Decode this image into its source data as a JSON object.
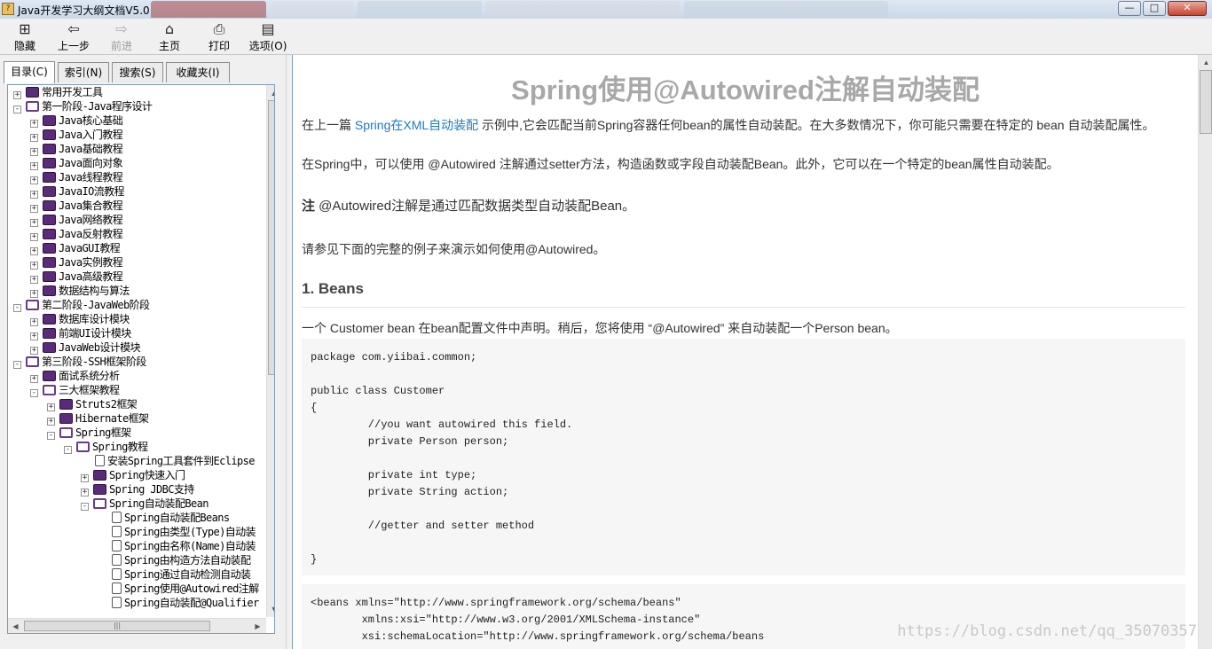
{
  "window": {
    "title": "Java开发学习大纲文档V5.0",
    "app_icon": "chm-book-icon",
    "controls": {
      "minimize": "—",
      "maximize": "□",
      "close": "✕"
    },
    "blurred_tab_colors": [
      "#a84444",
      "#d8dde4",
      "#c9d3df",
      "#d4d9e0",
      "#c8d2de"
    ]
  },
  "toolbar": {
    "buttons": [
      {
        "id": "hide",
        "label": "隐藏",
        "icon": "hide-pane-icon",
        "glyph": "⊞",
        "enabled": true
      },
      {
        "id": "back",
        "label": "上一步",
        "icon": "back-arrow-icon",
        "glyph": "⇦",
        "enabled": true
      },
      {
        "id": "forward",
        "label": "前进",
        "icon": "forward-arrow-icon",
        "glyph": "⇨",
        "enabled": false
      },
      {
        "id": "home",
        "label": "主页",
        "icon": "home-icon",
        "glyph": "⌂",
        "enabled": true
      },
      {
        "id": "print",
        "label": "打印",
        "icon": "printer-icon",
        "glyph": "⎙",
        "enabled": true
      },
      {
        "id": "options",
        "label": "选项(O)",
        "icon": "options-icon",
        "glyph": "▤",
        "enabled": true
      }
    ]
  },
  "nav_tabs": [
    {
      "label": "目录(C)",
      "active": true
    },
    {
      "label": "索引(N)",
      "active": false
    },
    {
      "label": "搜索(S)",
      "active": false
    },
    {
      "label": "收藏夹(I)",
      "active": false
    }
  ],
  "tree": [
    {
      "label": "常用开发工具",
      "level": 0,
      "expander": "+",
      "icon": "closed"
    },
    {
      "label": "第一阶段-Java程序设计",
      "level": 0,
      "expander": "-",
      "icon": "open"
    },
    {
      "label": "Java核心基础",
      "level": 1,
      "expander": "+",
      "icon": "closed"
    },
    {
      "label": "Java入门教程",
      "level": 1,
      "expander": "+",
      "icon": "closed"
    },
    {
      "label": "Java基础教程",
      "level": 1,
      "expander": "+",
      "icon": "closed"
    },
    {
      "label": "Java面向对象",
      "level": 1,
      "expander": "+",
      "icon": "closed"
    },
    {
      "label": "Java线程教程",
      "level": 1,
      "expander": "+",
      "icon": "closed"
    },
    {
      "label": "JavaIO流教程",
      "level": 1,
      "expander": "+",
      "icon": "closed"
    },
    {
      "label": "Java集合教程",
      "level": 1,
      "expander": "+",
      "icon": "closed"
    },
    {
      "label": "Java网络教程",
      "level": 1,
      "expander": "+",
      "icon": "closed"
    },
    {
      "label": "Java反射教程",
      "level": 1,
      "expander": "+",
      "icon": "closed"
    },
    {
      "label": "JavaGUI教程",
      "level": 1,
      "expander": "+",
      "icon": "closed"
    },
    {
      "label": "Java实例教程",
      "level": 1,
      "expander": "+",
      "icon": "closed"
    },
    {
      "label": "Java高级教程",
      "level": 1,
      "expander": "+",
      "icon": "closed"
    },
    {
      "label": "数据结构与算法",
      "level": 1,
      "expander": "+",
      "icon": "closed"
    },
    {
      "label": "第二阶段-JavaWeb阶段",
      "level": 0,
      "expander": "-",
      "icon": "open"
    },
    {
      "label": "数据库设计模块",
      "level": 1,
      "expander": "+",
      "icon": "closed"
    },
    {
      "label": "前端UI设计模块",
      "level": 1,
      "expander": "+",
      "icon": "closed"
    },
    {
      "label": "JavaWeb设计模块",
      "level": 1,
      "expander": "+",
      "icon": "closed"
    },
    {
      "label": "第三阶段-SSH框架阶段",
      "level": 0,
      "expander": "-",
      "icon": "open"
    },
    {
      "label": "面试系统分析",
      "level": 1,
      "expander": "+",
      "icon": "closed"
    },
    {
      "label": "三大框架教程",
      "level": 1,
      "expander": "-",
      "icon": "open"
    },
    {
      "label": "Struts2框架",
      "level": 2,
      "expander": "+",
      "icon": "closed"
    },
    {
      "label": "Hibernate框架",
      "level": 2,
      "expander": "+",
      "icon": "closed"
    },
    {
      "label": "Spring框架",
      "level": 2,
      "expander": "-",
      "icon": "open"
    },
    {
      "label": "Spring教程",
      "level": 3,
      "expander": "-",
      "icon": "open"
    },
    {
      "label": "安装Spring工具套件到Eclipse",
      "level": 4,
      "expander": "",
      "icon": "page"
    },
    {
      "label": "Spring快速入门",
      "level": 4,
      "expander": "+",
      "icon": "closed"
    },
    {
      "label": "Spring JDBC支持",
      "level": 4,
      "expander": "+",
      "icon": "closed"
    },
    {
      "label": "Spring自动装配Bean",
      "level": 4,
      "expander": "-",
      "icon": "open"
    },
    {
      "label": "Spring自动装配Beans",
      "level": 5,
      "expander": "",
      "icon": "page"
    },
    {
      "label": "Spring由类型(Type)自动装",
      "level": 5,
      "expander": "",
      "icon": "page"
    },
    {
      "label": "Spring由名称(Name)自动装",
      "level": 5,
      "expander": "",
      "icon": "page"
    },
    {
      "label": "Spring由构造方法自动装配",
      "level": 5,
      "expander": "",
      "icon": "page"
    },
    {
      "label": "Spring通过自动检测自动装",
      "level": 5,
      "expander": "",
      "icon": "page"
    },
    {
      "label": "Spring使用@Autowired注解",
      "level": 5,
      "expander": "",
      "icon": "page"
    },
    {
      "label": "Spring自动装配@Qualifier",
      "level": 5,
      "expander": "",
      "icon": "page"
    }
  ],
  "content": {
    "title": "Spring使用@Autowired注解自动装配",
    "p1_prefix": "在上一篇 ",
    "p1_link": "Spring在XML自动装配",
    "p1_suffix": " 示例中,它会匹配当前Spring容器任何bean的属性自动装配。在大多数情况下，你可能只需要在特定的 bean 自动装配属性。",
    "p2": "在Spring中，可以使用 @Autowired 注解通过setter方法，构造函数或字段自动装配Bean。此外，它可以在一个特定的bean属性自动装配。",
    "note_label": "注",
    "note_text": " @Autowired注解是通过匹配数据类型自动装配Bean。",
    "p3": "请参见下面的完整的例子来演示如何使用@Autowired。",
    "h_beans": "1. Beans",
    "p4": "一个 Customer bean 在bean配置文件中声明。稍后，您将使用 “@Autowired” 来自动装配一个Person bean。",
    "code1": "package com.yiibai.common;\n\npublic class Customer\n{\n         //you want autowired this field.\n         private Person person;\n\n         private int type;\n         private String action;\n\n         //getter and setter method\n\n}",
    "code2": "<beans xmlns=\"http://www.springframework.org/schema/beans\"\n        xmlns:xsi=\"http://www.w3.org/2001/XMLSchema-instance\"\n        xsi:schemaLocation=\"http://www.springframework.org/schema/beans",
    "watermark": "https://blog.csdn.net/qq_35070357"
  }
}
